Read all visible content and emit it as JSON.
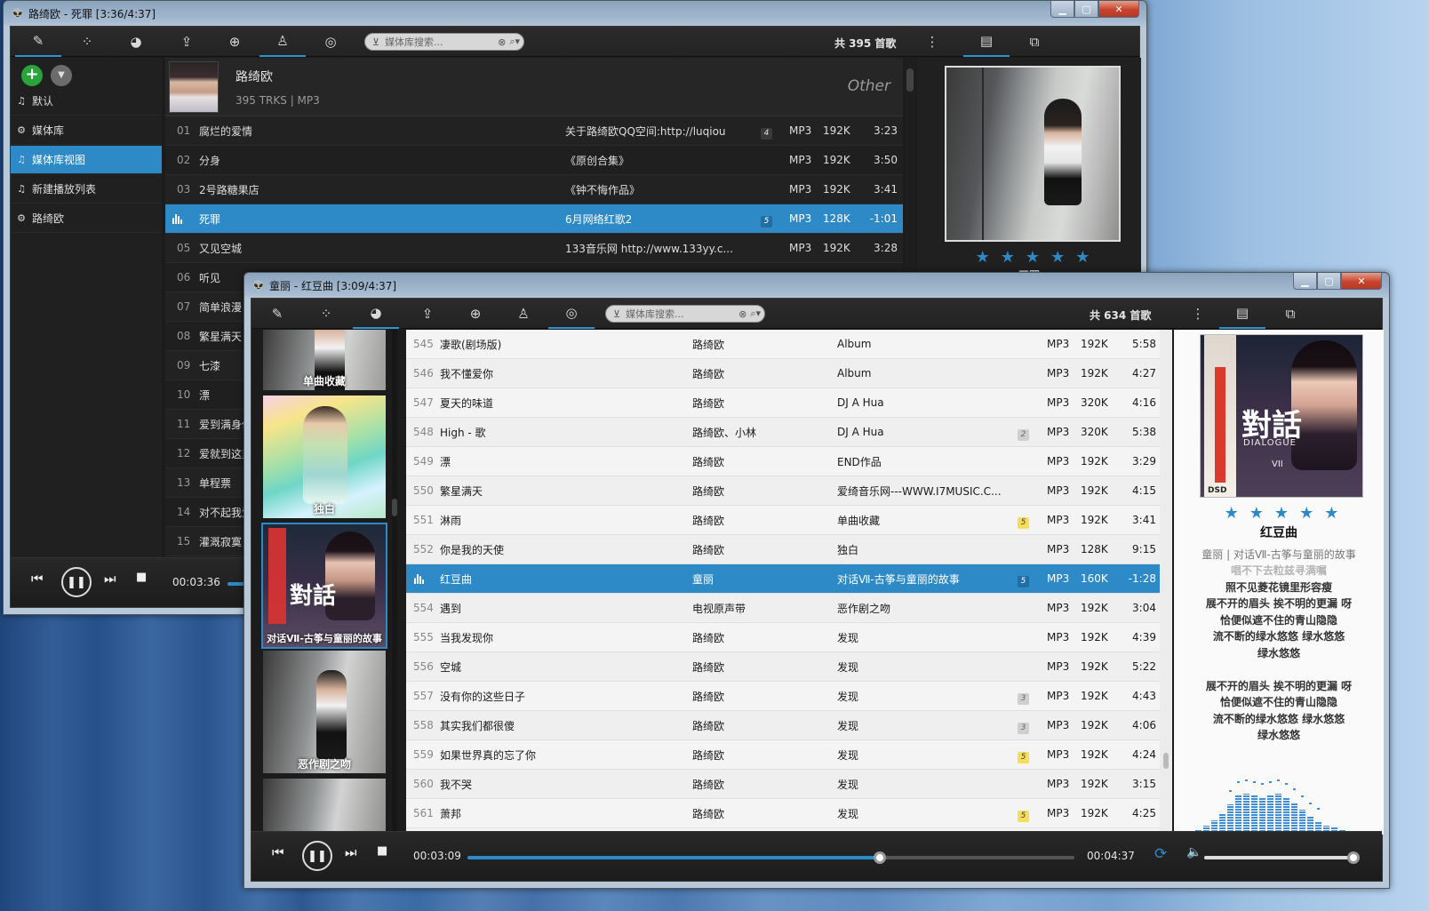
{
  "back_window": {
    "title": "路绮欧 - 死罪 [3:36/4:37]",
    "search_placeholder": "媒体库搜索...",
    "count": "共 395 首歌",
    "sidebar": [
      "默认",
      "媒体库",
      "媒体库视图",
      "新建播放列表",
      "路绮欧"
    ],
    "artist": {
      "name": "路绮欧",
      "meta": "395 TRKS | MP3",
      "genre": "Other"
    },
    "tracks": [
      {
        "n": "01",
        "t": "腐烂的爱情",
        "a": "关于路绮欧QQ空间:http://luqiou",
        "b": "4",
        "f": "MP3",
        "k": "192K",
        "d": "3:23"
      },
      {
        "n": "02",
        "t": "分身",
        "a": "《原创合集》",
        "b": "",
        "f": "MP3",
        "k": "192K",
        "d": "3:50"
      },
      {
        "n": "03",
        "t": "2号路糖果店",
        "a": "《钟不悔作品》",
        "b": "",
        "f": "MP3",
        "k": "192K",
        "d": "3:41"
      },
      {
        "n": "",
        "t": "死罪",
        "a": "6月网络红歌2",
        "b": "5",
        "f": "MP3",
        "k": "128K",
        "d": "-1:01"
      },
      {
        "n": "05",
        "t": "又见空城",
        "a": "133音乐网 http://www.133yy.c...",
        "b": "",
        "f": "MP3",
        "k": "192K",
        "d": "3:28"
      },
      {
        "n": "06",
        "t": "听见"
      },
      {
        "n": "07",
        "t": "简单浪漫"
      },
      {
        "n": "08",
        "t": "繁星满天"
      },
      {
        "n": "09",
        "t": "七漆"
      },
      {
        "n": "10",
        "t": "漂"
      },
      {
        "n": "11",
        "t": "爱到满身伤"
      },
      {
        "n": "12",
        "t": "爱就到这里"
      },
      {
        "n": "13",
        "t": "单程票"
      },
      {
        "n": "14",
        "t": "对不起我爱"
      },
      {
        "n": "15",
        "t": "灌溉寂寞"
      }
    ],
    "time": "00:03:36",
    "stars": [
      "★",
      "★",
      "★",
      "★",
      "★"
    ],
    "cover_caption": "开罪"
  },
  "front_window": {
    "title": "童丽 - 红豆曲 [3:09/4:37]",
    "search_placeholder": "媒体库搜索...",
    "count": "共 634 首歌",
    "albums": [
      "单曲收藏",
      "独白",
      "对话Ⅶ-古筝与童丽的故事",
      "恶作剧之吻"
    ],
    "tracks": [
      {
        "n": "545",
        "t": "凄歌(剧场版)",
        "ar": "路绮欧",
        "al": "Album",
        "b": "",
        "f": "MP3",
        "k": "192K",
        "d": "5:58"
      },
      {
        "n": "546",
        "t": "我不懂爱你",
        "ar": "路绮欧",
        "al": "Album",
        "b": "",
        "f": "MP3",
        "k": "192K",
        "d": "4:27"
      },
      {
        "n": "547",
        "t": "夏天的味道",
        "ar": "路绮欧",
        "al": "DJ A Hua",
        "b": "",
        "f": "MP3",
        "k": "320K",
        "d": "4:16"
      },
      {
        "n": "548",
        "t": "High - 歌",
        "ar": "路绮欧、小林",
        "al": "DJ A Hua",
        "b": "2",
        "f": "MP3",
        "k": "320K",
        "d": "5:38"
      },
      {
        "n": "549",
        "t": "漂",
        "ar": "路绮欧",
        "al": "END作品",
        "b": "",
        "f": "MP3",
        "k": "192K",
        "d": "3:29"
      },
      {
        "n": "550",
        "t": "繁星满天",
        "ar": "路绮欧",
        "al": "爱绮音乐网---WWW.I7MUSIC.C...",
        "b": "",
        "f": "MP3",
        "k": "192K",
        "d": "4:15"
      },
      {
        "n": "551",
        "t": "淋雨",
        "ar": "路绮欧",
        "al": "单曲收藏",
        "b": "5",
        "f": "MP3",
        "k": "192K",
        "d": "3:41"
      },
      {
        "n": "552",
        "t": "你是我的天使",
        "ar": "路绮欧",
        "al": "独白",
        "b": "",
        "f": "MP3",
        "k": "128K",
        "d": "9:15"
      },
      {
        "n": "",
        "t": "红豆曲",
        "ar": "童丽",
        "al": "对话Ⅶ-古筝与童丽的故事",
        "b": "5",
        "f": "MP3",
        "k": "160K",
        "d": "-1:28"
      },
      {
        "n": "554",
        "t": "遇到",
        "ar": "电视原声带",
        "al": "恶作剧之吻",
        "b": "",
        "f": "MP3",
        "k": "192K",
        "d": "3:04"
      },
      {
        "n": "555",
        "t": "当我发现你",
        "ar": "路绮欧",
        "al": "发现",
        "b": "",
        "f": "MP3",
        "k": "192K",
        "d": "4:39"
      },
      {
        "n": "556",
        "t": "空城",
        "ar": "路绮欧",
        "al": "发现",
        "b": "",
        "f": "MP3",
        "k": "192K",
        "d": "5:22"
      },
      {
        "n": "557",
        "t": "没有你的这些日子",
        "ar": "路绮欧",
        "al": "发现",
        "b": "3",
        "f": "MP3",
        "k": "192K",
        "d": "4:43"
      },
      {
        "n": "558",
        "t": "其实我们都很傻",
        "ar": "路绮欧",
        "al": "发现",
        "b": "3",
        "f": "MP3",
        "k": "192K",
        "d": "4:06"
      },
      {
        "n": "559",
        "t": "如果世界真的忘了你",
        "ar": "路绮欧",
        "al": "发现",
        "b": "5",
        "f": "MP3",
        "k": "192K",
        "d": "4:24"
      },
      {
        "n": "560",
        "t": "我不哭",
        "ar": "路绮欧",
        "al": "发现",
        "b": "",
        "f": "MP3",
        "k": "192K",
        "d": "3:15"
      },
      {
        "n": "561",
        "t": "萧邦",
        "ar": "路绮欧",
        "al": "发现",
        "b": "5",
        "f": "MP3",
        "k": "192K",
        "d": "4:25"
      }
    ],
    "now": {
      "title": "红豆曲",
      "sub": "童丽 | 对话Ⅶ-古筝与童丽的故事"
    },
    "lyrics": [
      "唱不下去粒兹寻满嘱",
      "照不见菱花镜里形容瘦",
      "展不开的眉头 挨不明的更漏 呀",
      "恰便似遮不住的青山隐隐",
      "流不断的绿水悠悠 绿水悠悠",
      "绿水悠悠",
      "",
      "展不开的眉头 挨不明的更漏 呀",
      "恰便似遮不住的青山隐隐",
      "流不断的绿水悠悠 绿水悠悠",
      "绿水悠悠"
    ],
    "stars": [
      "★",
      "★",
      "★",
      "★",
      "★"
    ],
    "time_cur": "00:03:09",
    "time_total": "00:04:37",
    "progress": 0.68,
    "volume": 1.0,
    "cover_text": {
      "big": "對話",
      "sub": "DIALOGUE",
      "num": "VII",
      "dsd": "DSD"
    }
  },
  "accent": "#2e8ac6"
}
